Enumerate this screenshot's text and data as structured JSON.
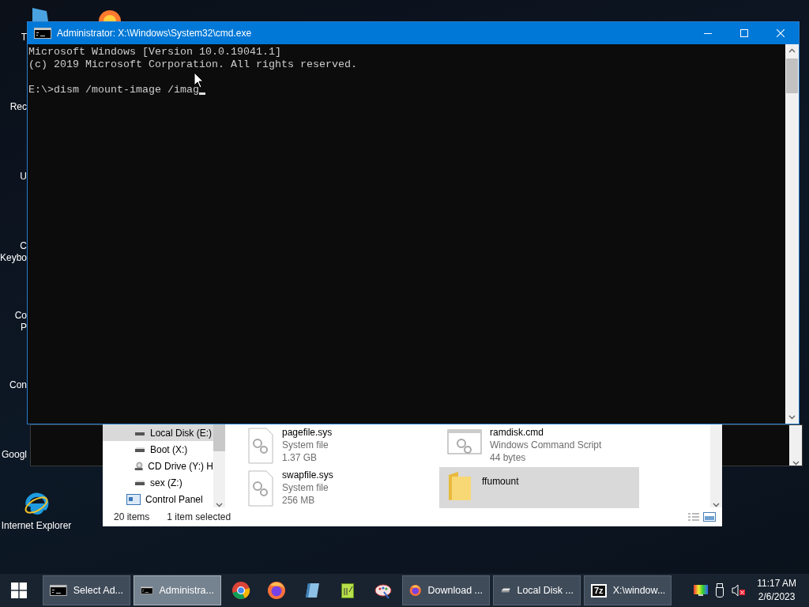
{
  "desktop": {
    "icons": [
      {
        "label": "T",
        "covered": true
      },
      {
        "label": "Rec",
        "covered": true
      },
      {
        "label": "U",
        "covered": true
      },
      {
        "label": "C\nKeybo",
        "covered": true
      },
      {
        "label": "Co\nP",
        "covered": true
      },
      {
        "label": "Con",
        "covered": true
      },
      {
        "label": "Googl",
        "covered": true
      },
      {
        "label": "Internet Explorer",
        "covered": false
      }
    ]
  },
  "console_window": {
    "title": "Administrator: X:\\Windows\\System32\\cmd.exe",
    "output": [
      "Microsoft Windows [Version 10.0.19041.1]",
      "(c) 2019 Microsoft Corporation. All rights reserved."
    ],
    "prompt": "E:\\>dism /mount-image /imag",
    "cursor_visible": true
  },
  "explorer": {
    "nav_items": [
      {
        "label": "Local Disk (E:)",
        "kind": "drive",
        "selected": true
      },
      {
        "label": "Boot (X:)",
        "kind": "drive",
        "selected": false
      },
      {
        "label": "CD Drive (Y:) H",
        "kind": "cd",
        "selected": false
      },
      {
        "label": "sex (Z:)",
        "kind": "drive",
        "selected": false
      },
      {
        "label": "Control Panel",
        "kind": "panel",
        "selected": false
      }
    ],
    "files": [
      {
        "name": "pagefile.sys",
        "kind": "system",
        "type": "System file",
        "size": "1.37 GB",
        "selected": false
      },
      {
        "name": "ramdisk.cmd",
        "kind": "script",
        "type": "Windows Command Script",
        "size": "44 bytes",
        "selected": false
      },
      {
        "name": "swapfile.sys",
        "kind": "system",
        "type": "System file",
        "size": "256 MB",
        "selected": false
      },
      {
        "name": "ffumount",
        "kind": "folder",
        "selected": true
      }
    ],
    "status": {
      "count": "20 items",
      "selection": "1 item selected"
    }
  },
  "taskbar": {
    "items": [
      {
        "kind": "console",
        "label": "Select Ad...",
        "selected": false
      },
      {
        "kind": "console",
        "label": "Administra...",
        "selected": true
      },
      {
        "kind": "chrome"
      },
      {
        "kind": "firefox"
      },
      {
        "kind": "notebook"
      },
      {
        "kind": "notepad"
      },
      {
        "kind": "paint"
      },
      {
        "kind": "firefox",
        "label": "Download ...",
        "selected": false
      },
      {
        "kind": "drive",
        "label": "Local Disk ...",
        "selected": false
      },
      {
        "kind": "archive",
        "logo": "7z",
        "label": "X:\\window...",
        "selected": false
      }
    ],
    "clock": {
      "time": "11:17 AM",
      "date": "2/6/2023"
    }
  }
}
